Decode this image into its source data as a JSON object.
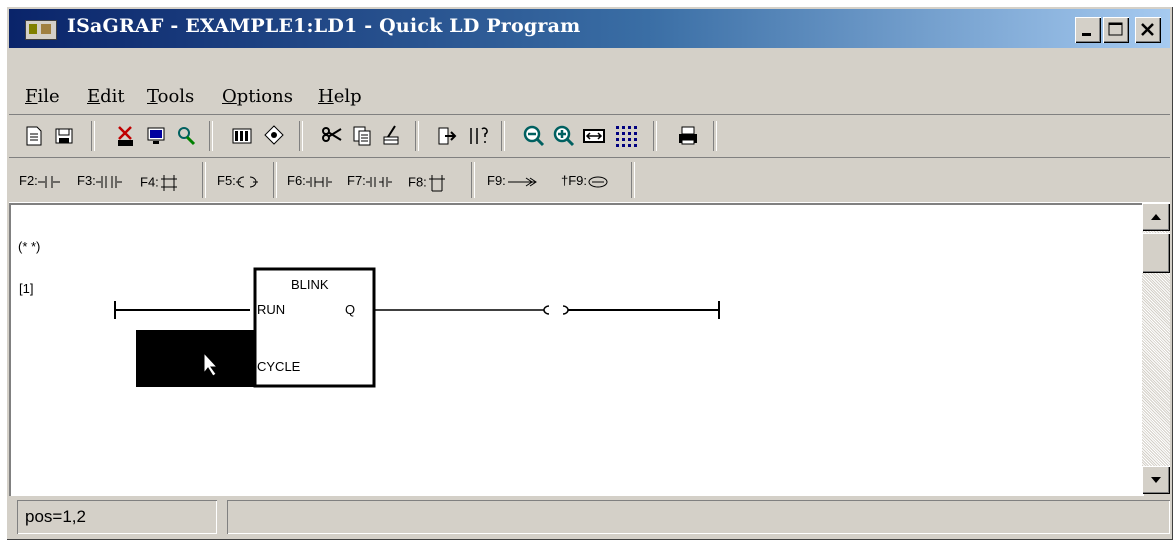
{
  "window": {
    "title": "ISaGRAF - EXAMPLE1:LD1 - Quick LD Program",
    "icon": "isagraf-app-icon",
    "controls": [
      "minimize-icon",
      "maximize-icon",
      "close-icon"
    ]
  },
  "menu": {
    "items": [
      {
        "key": "F",
        "rest": "ile"
      },
      {
        "key": "E",
        "rest": "dit"
      },
      {
        "key": "T",
        "rest": "ools"
      },
      {
        "key": "O",
        "rest": "ptions"
      },
      {
        "key": "H",
        "rest": "elp"
      }
    ]
  },
  "toolbar": {
    "icons": [
      "new-page-icon",
      "save-icon",
      "cut-icon",
      "monitor-icon",
      "search-icon",
      "chart-icon",
      "network-icon",
      "scissors-icon",
      "copy-icon",
      "paint-icon",
      "goto-icon",
      "undo-icon",
      "zoom-out-icon",
      "zoom-in-icon",
      "fit-icon",
      "grid-icon",
      "print-icon"
    ]
  },
  "ld_toolbar": {
    "f2": "F2:",
    "f3": "F3:",
    "f4": "F4:",
    "f5": "F5:",
    "f6": "F6:",
    "f7": "F7:",
    "f8": "F8:",
    "f9": "F9:",
    "sf9": "†F9:"
  },
  "diagram": {
    "comment": "(* *)",
    "rung_label": "[1]",
    "block_name": "BLINK",
    "input_run": "RUN",
    "input_cycle": "CYCLE",
    "output_q": "Q",
    "coil": "( )"
  },
  "status": {
    "position": "pos=1,2",
    "message": ""
  },
  "colors": {
    "titlebar_start": "#0a246a",
    "titlebar_end": "#a6caf0",
    "face": "#d4d0c8"
  }
}
